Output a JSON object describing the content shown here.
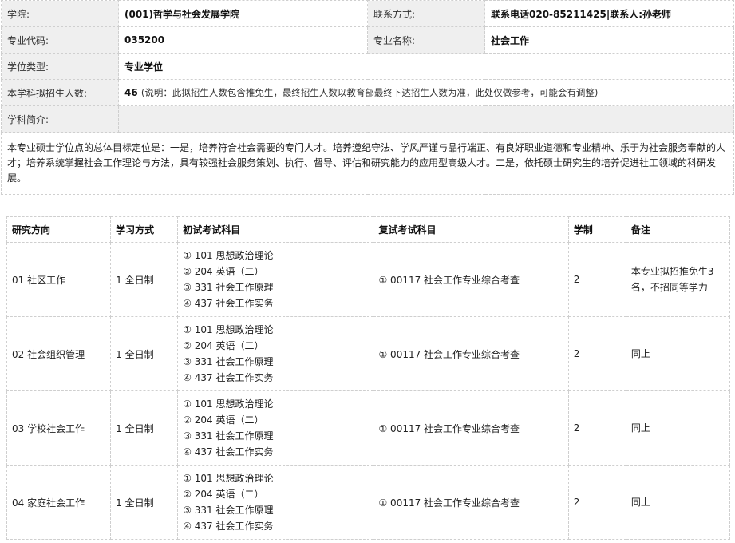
{
  "info": {
    "college_label": "学院:",
    "college_value": "(001)哲学与社会发展学院",
    "contact_label": "联系方式:",
    "contact_value": "联系电话020-85211425|联系人:孙老师",
    "code_label": "专业代码:",
    "code_value": "035200",
    "major_label": "专业名称:",
    "major_value": "社会工作",
    "degree_label": "学位类型:",
    "degree_value": "专业学位",
    "enroll_label": "本学科拟招生人数:",
    "enroll_value": "46",
    "enroll_note": "(说明：此拟招生人数包含推免生，最终招生人数以教育部最终下达招生人数为准，此处仅做参考，可能会有调整)",
    "intro_label": "学科简介:",
    "intro_text": "本专业硕士学位点的总体目标定位是：一是，培养符合社会需要的专门人才。培养遵纪守法、学风严谨与品行端正、有良好职业道德和专业精神、乐于为社会服务奉献的人才；培养系统掌握社会工作理论与方法，具有较强社会服务策划、执行、督导、评估和研究能力的应用型高级人才。二是，依托硕士研究生的培养促进社工领域的科研发展。"
  },
  "plan": {
    "headers": [
      "研究方向",
      "学习方式",
      "初试考试科目",
      "复试考试科目",
      "学制",
      "备注"
    ],
    "rows": [
      {
        "direction": "01 社区工作",
        "mode": "1 全日制",
        "subjects": [
          "①  101  思想政治理论",
          "②  204  英语（二）",
          "③  331  社会工作原理",
          "④  437  社会工作实务"
        ],
        "retest": "①  00117  社会工作专业综合考查",
        "years": "2",
        "remark": "本专业拟招推免生3名，不招同等学力"
      },
      {
        "direction": "02 社会组织管理",
        "mode": "1 全日制",
        "subjects": [
          "①  101  思想政治理论",
          "②  204  英语（二）",
          "③  331  社会工作原理",
          "④  437  社会工作实务"
        ],
        "retest": "①  00117  社会工作专业综合考查",
        "years": "2",
        "remark": "同上"
      },
      {
        "direction": "03 学校社会工作",
        "mode": "1 全日制",
        "subjects": [
          "①  101  思想政治理论",
          "②  204  英语（二）",
          "③  331  社会工作原理",
          "④  437  社会工作实务"
        ],
        "retest": "①  00117  社会工作专业综合考查",
        "years": "2",
        "remark": "同上"
      },
      {
        "direction": "04 家庭社会工作",
        "mode": "1 全日制",
        "subjects": [
          "①  101  思想政治理论",
          "②  204  英语（二）",
          "③  331  社会工作原理",
          "④  437  社会工作实务"
        ],
        "retest": "①  00117  社会工作专业综合考查",
        "years": "2",
        "remark": "同上"
      }
    ]
  }
}
